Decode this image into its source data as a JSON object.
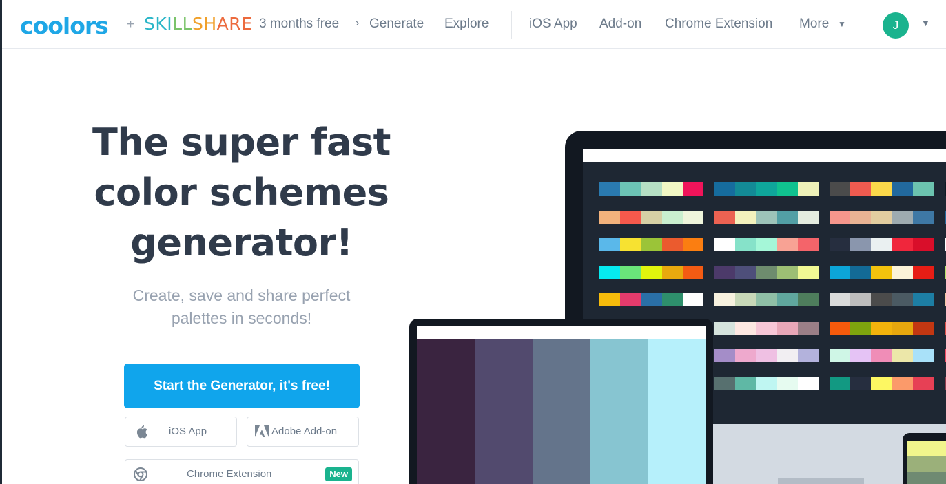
{
  "header": {
    "logo": "coolors",
    "plus": "+",
    "skillshare": [
      "SKI",
      "LL",
      "SH",
      "ARE"
    ],
    "promo": "3 months free",
    "nav": [
      "Generate",
      "Explore",
      "iOS App",
      "Add-on",
      "Chrome Extension",
      "More"
    ],
    "avatar_initial": "J"
  },
  "hero": {
    "title": "The super fast color schemes generator!",
    "subtitle": "Create, save and share perfect palettes in seconds!",
    "cta_label": "Start the Generator, it's free!",
    "ios_label": "iOS App",
    "adobe_label": "Adobe Add-on",
    "chrome_label": "Chrome Extension",
    "new_badge": "New"
  },
  "colors": {
    "accent": "#10a5ec",
    "green": "#1ab38e",
    "dark_device": "#121821"
  },
  "icons": [
    "apple-icon",
    "adobe-icon",
    "chrome-icon",
    "chevron-down-icon",
    "chevron-right-icon"
  ],
  "palettes": {
    "col1": [
      [
        "#2a7ab0",
        "#6cc3b5",
        "#b6dfc4",
        "#f1f7c4",
        "#f0145a"
      ],
      [
        "#f2b27c",
        "#f6594c",
        "#d6d0a5",
        "#c9efcf",
        "#eef5dc"
      ],
      [
        "#5ab8ea",
        "#f7e231",
        "#9bc438",
        "#eb5b2e",
        "#fb7e11"
      ],
      [
        "#06eaf0",
        "#6ae57a",
        "#e1f40d",
        "#e8a90e",
        "#f45b13"
      ],
      [
        "#f6bb0b",
        "#e43b6c",
        "#2a6fa6",
        "#2e8f6c",
        "#ffffff"
      ]
    ],
    "col2": [
      [
        "#166c9e",
        "#138a96",
        "#0fa69b",
        "#10c28f",
        "#eef1b9"
      ],
      [
        "#ec6252",
        "#f3f1bd",
        "#9dc3b9",
        "#529fa5",
        "#e4ece0"
      ],
      [
        "#ffffff",
        "#86e2c9",
        "#a5f7d8",
        "#f8a294",
        "#f4646a"
      ],
      [
        "#4c3a6a",
        "#4e4f7a",
        "#6e8c6e",
        "#9dbf74",
        "#f1f994"
      ],
      [
        "#f7f1df",
        "#c8d8b8",
        "#8fbfa6",
        "#60a79e",
        "#4e7d5c"
      ],
      [
        "#d5e3dd",
        "#fde8e2",
        "#f7c7d7",
        "#e8a7b8",
        "#9b7f87"
      ],
      [
        "#a48dc8",
        "#eea9cd",
        "#efc0e3",
        "#f1eef2",
        "#b3b2dc"
      ],
      [
        "#57706f",
        "#5fb8a5",
        "#bff6f2",
        "#e6fbf0",
        "#ffffff"
      ]
    ],
    "col3": [
      [
        "#4b4b4b",
        "#ef5b50",
        "#fbd84a",
        "#22699e",
        "#6cc3af"
      ],
      [
        "#f6968c",
        "#e8b394",
        "#e2cda0",
        "#9eabb0",
        "#3e78a5"
      ],
      [
        "#262e3f",
        "#8a96ad",
        "#eaf0f1",
        "#f0263c",
        "#d90e2a"
      ],
      [
        "#0ca5d8",
        "#136a96",
        "#f2c20d",
        "#fbf3d8",
        "#e71d15"
      ],
      [
        "#dadbdb",
        "#bdbdbd",
        "#4b4b4b",
        "#4b5a63",
        "#1d7ea4"
      ],
      [
        "#f65a0c",
        "#7ea40e",
        "#f2b30c",
        "#e7a70e",
        "#c33712"
      ],
      [
        "#cff6e6",
        "#e5c3f5",
        "#f08db7",
        "#ece7a9",
        "#a9e1f9"
      ],
      [
        "#129982",
        "#262e3f",
        "#fdf762",
        "#fb9a6a",
        "#e74055"
      ]
    ],
    "col4": [
      "#0e1a24",
      "#25699c",
      "#ffffff",
      "#b5e26a",
      "#f5c9a5",
      "#e0524b",
      "#f24a63",
      "#8f3d4f"
    ],
    "laptop": [
      "#3a2440",
      "#524a6e",
      "#64748b",
      "#87c5d1",
      "#b6f0fb"
    ],
    "phone": [
      "#f1f58c",
      "#9bb07a",
      "#6f8a72"
    ]
  }
}
